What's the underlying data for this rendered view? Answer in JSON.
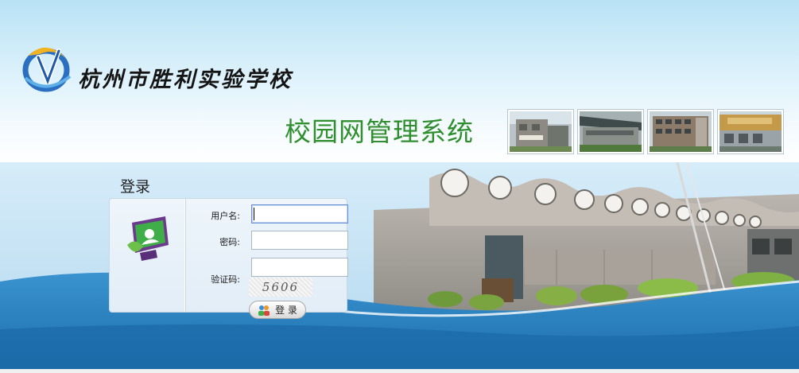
{
  "header": {
    "school_name": "杭州市胜利实验学校",
    "system_title": "校园网管理系统",
    "thumbnails": [
      {
        "icon": "building-photo-1"
      },
      {
        "icon": "building-photo-2"
      },
      {
        "icon": "building-photo-3"
      },
      {
        "icon": "building-photo-4"
      }
    ]
  },
  "login": {
    "heading": "登录",
    "username_label": "用户名:",
    "username_value": "",
    "password_label": "密码:",
    "password_value": "",
    "captcha_label": "验证码:",
    "captcha_value": "",
    "captcha_image_text": "5606",
    "submit_label": "登 录"
  },
  "colors": {
    "title_green": "#2f8f2f",
    "banner_blue": "#1d78b8",
    "panel_bg": "#e2edf7"
  }
}
